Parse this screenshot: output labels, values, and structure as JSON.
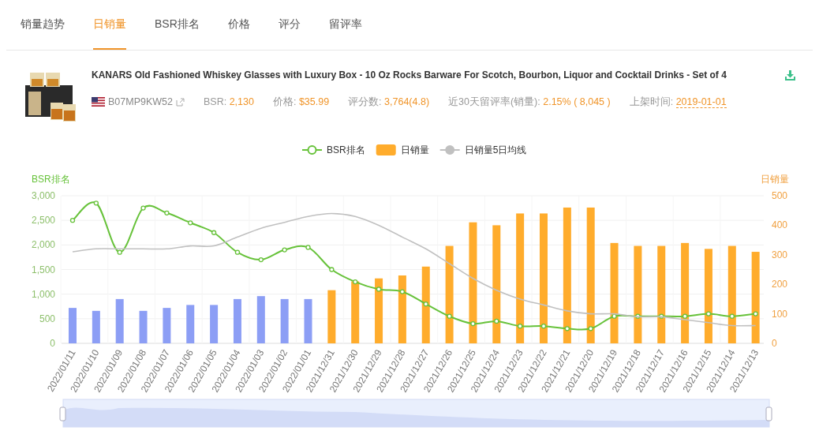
{
  "tabs": [
    {
      "label": "销量趋势",
      "selected": false
    },
    {
      "label": "日销量",
      "selected": true
    },
    {
      "label": "BSR排名",
      "selected": false
    },
    {
      "label": "价格",
      "selected": false
    },
    {
      "label": "评分",
      "selected": false
    },
    {
      "label": "留评率",
      "selected": false
    }
  ],
  "product": {
    "title": "KANARS Old Fashioned Whiskey Glasses with Luxury Box - 10 Oz Rocks Barware For Scotch, Bourbon, Liquor and Cocktail Drinks - Set of 4",
    "asin": "B07MP9KW52",
    "stats": [
      {
        "label": "BSR:",
        "value": "2,130"
      },
      {
        "label": "价格:",
        "value": "$35.99"
      },
      {
        "label": "评分数:",
        "value": "3,764(4.8)"
      },
      {
        "label": "近30天留评率(销量):",
        "value": "2.15% ( 8,045 )"
      },
      {
        "label": "上架时间:",
        "value": "2019-01-01",
        "underlined": true
      }
    ]
  },
  "chart": {
    "chart_data": {
      "type": "bar",
      "grid": true,
      "legend": true,
      "ylabel": "BSR排名",
      "y2label": "日销量",
      "categories": [
        "2022/01/11",
        "2022/01/10",
        "2022/01/09",
        "2022/01/08",
        "2022/01/07",
        "2022/01/06",
        "2022/01/05",
        "2022/01/04",
        "2022/01/03",
        "2022/01/02",
        "2022/01/01",
        "2021/12/31",
        "2021/12/30",
        "2021/12/29",
        "2021/12/28",
        "2021/12/27",
        "2021/12/26",
        "2021/12/25",
        "2021/12/24",
        "2021/12/23",
        "2021/12/22",
        "2021/12/21",
        "2021/12/20",
        "2021/12/19",
        "2021/12/18",
        "2021/12/17",
        "2021/12/16",
        "2021/12/15",
        "2021/12/14",
        "2021/12/13"
      ],
      "series": [
        {
          "name": "BSR排名",
          "type": "line",
          "marker": "circle",
          "axis": "y",
          "color": "#67c23a",
          "values": [
            2500,
            2850,
            1850,
            2750,
            2650,
            2450,
            2250,
            1850,
            1700,
            1900,
            1950,
            1500,
            1250,
            1100,
            1050,
            800,
            550,
            400,
            450,
            350,
            350,
            300,
            300,
            550,
            550,
            550,
            550,
            600,
            550,
            600
          ]
        },
        {
          "name": "日销量",
          "type": "bar",
          "axis": "y2",
          "color": "#ffac2c",
          "colors": [
            "#8c9ef5",
            "#8c9ef5",
            "#8c9ef5",
            "#8c9ef5",
            "#8c9ef5",
            "#8c9ef5",
            "#8c9ef5",
            "#8c9ef5",
            "#8c9ef5",
            "#8c9ef5",
            "#8c9ef5",
            "#ffac2c",
            "#ffac2c",
            "#ffac2c",
            "#ffac2c",
            "#ffac2c",
            "#ffac2c",
            "#ffac2c",
            "#ffac2c",
            "#ffac2c",
            "#ffac2c",
            "#ffac2c",
            "#ffac2c",
            "#ffac2c",
            "#ffac2c",
            "#ffac2c",
            "#ffac2c",
            "#ffac2c",
            "#ffac2c",
            "#ffac2c"
          ],
          "values": [
            120,
            110,
            150,
            110,
            120,
            130,
            130,
            150,
            160,
            150,
            150,
            180,
            210,
            220,
            230,
            260,
            330,
            410,
            400,
            440,
            440,
            460,
            460,
            340,
            330,
            330,
            340,
            320,
            330,
            310
          ]
        },
        {
          "name": "日销量5日均线",
          "type": "line",
          "axis": "y2",
          "color": "#c0c0c0",
          "values": [
            310,
            320,
            320,
            320,
            320,
            330,
            330,
            360,
            390,
            410,
            430,
            440,
            430,
            400,
            360,
            320,
            270,
            220,
            180,
            150,
            130,
            110,
            100,
            100,
            90,
            90,
            80,
            70,
            60,
            60
          ]
        }
      ],
      "ylim": [
        0,
        3000
      ],
      "yticks": [
        {
          "value": 0,
          "label": "0"
        },
        {
          "value": 500,
          "label": "500"
        },
        {
          "value": 1000,
          "label": "1,000"
        },
        {
          "value": 1500,
          "label": "1,500"
        },
        {
          "value": 2000,
          "label": "2,000"
        },
        {
          "value": 2500,
          "label": "2,500"
        },
        {
          "value": 3000,
          "label": "3,000"
        }
      ],
      "y2lim": [
        0,
        500
      ],
      "y2ticks": [
        0,
        100,
        200,
        300,
        400,
        500
      ]
    }
  }
}
